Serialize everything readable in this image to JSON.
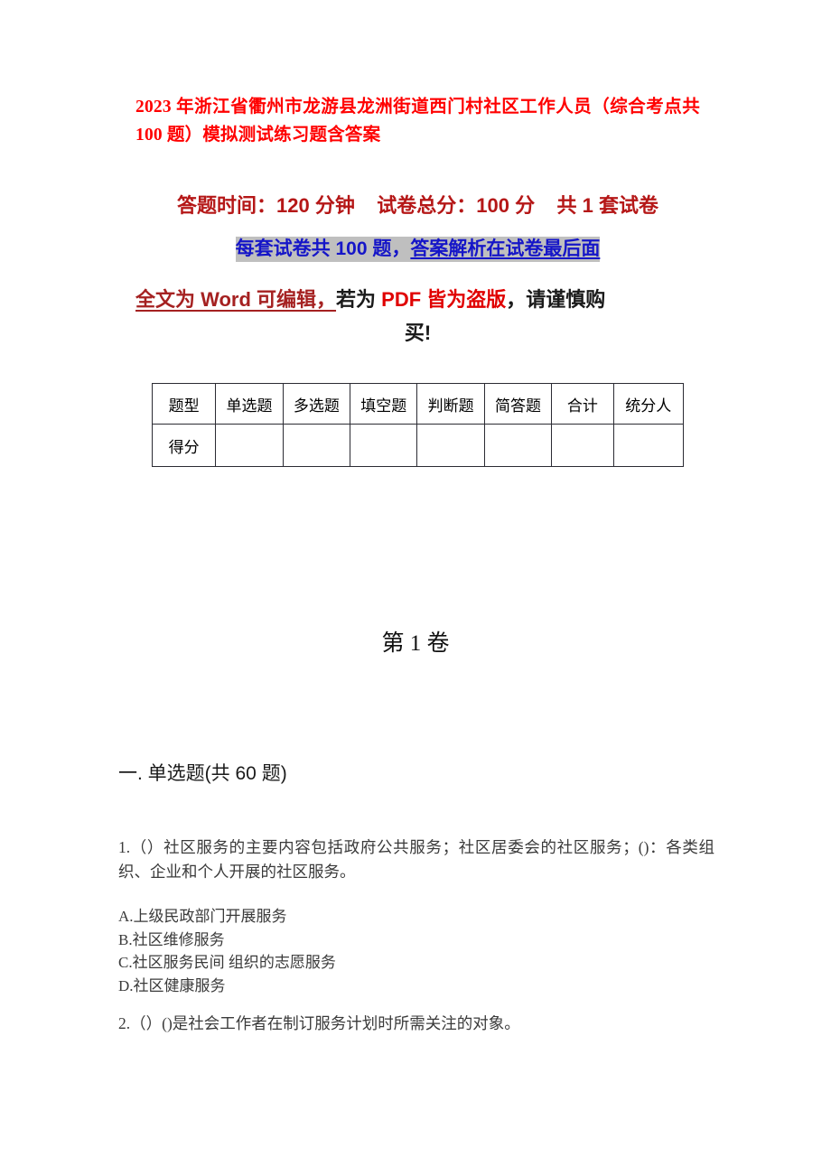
{
  "document": {
    "title": "2023 年浙江省衢州市龙游县龙洲街道西门村社区工作人员（综合考点共 100 题）模拟测试练习题含答案",
    "notice_line1": "答题时间：120 分钟    试卷总分：100 分    共 1 套试卷",
    "notice_line2_plain": "每套试卷共 100 题，",
    "notice_line2_underlined": "答案解析在试卷最后面",
    "notice_line3_part1": "全文为 Word 可编辑，",
    "notice_line3_part2": "若为 ",
    "notice_line3_part3": "PDF 皆为盗版",
    "notice_line3_part4": "，请谨慎购",
    "notice_line3_wrap": "买!",
    "volume_heading": "第 1 卷",
    "section_heading": "一. 单选题(共 60 题)"
  },
  "colors": {
    "title_red": "#FF0000",
    "notice_dark_red": "#B51717",
    "notice_blue": "#1515C8",
    "highlight_gray": "#BFBFBF",
    "dark_red": "#A52121",
    "bright_red": "#E00000",
    "body_text": "#3a3a3a",
    "table_border": "#2b2b33"
  },
  "score_table": {
    "headers": [
      "题型",
      "单选题",
      "多选题",
      "填空题",
      "判断题",
      "简答题",
      "合计",
      "统分人"
    ],
    "rows": [
      {
        "label": "得分",
        "cells": [
          "",
          "",
          "",
          "",
          "",
          "",
          ""
        ]
      }
    ]
  },
  "questions": [
    {
      "number": "1.",
      "text": "1.（）社区服务的主要内容包括政府公共服务；社区居委会的社区服务；()：各类组织、企业和个人开展的社区服务。",
      "options": [
        "A.上级民政部门开展服务",
        "B.社区维修服务",
        "C.社区服务民间 组织的志愿服务",
        "D.社区健康服务"
      ]
    },
    {
      "number": "2.",
      "text": "2.（）()是社会工作者在制订服务计划时所需关注的对象。",
      "options": []
    }
  ]
}
